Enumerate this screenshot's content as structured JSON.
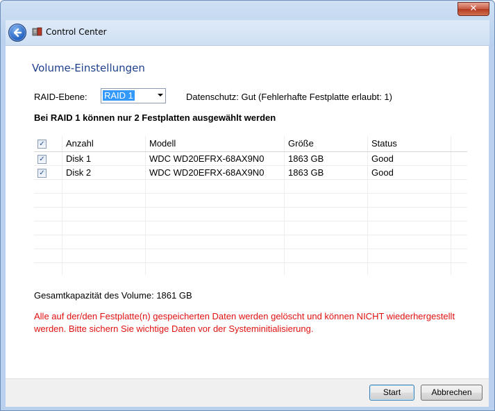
{
  "window": {
    "close_glyph": "✕",
    "app_title": "Control Center"
  },
  "page": {
    "title": "Volume-Einstellungen",
    "raid_label": "RAID-Ebene:",
    "raid_value": "RAID 1",
    "protection_text": "Datenschutz: Gut (Fehlerhafte Festplatte erlaubt: 1)",
    "raid_note": "Bei RAID 1 können nur 2 Festplatten ausgewählt werden"
  },
  "table": {
    "header_all_checked": true,
    "columns": [
      "Anzahl",
      "Modell",
      "Größe",
      "Status"
    ],
    "rows": [
      {
        "checked": true,
        "anzahl": "Disk 1",
        "modell": "WDC WD20EFRX-68AX9N0",
        "groesse": "1863 GB",
        "status": "Good"
      },
      {
        "checked": true,
        "anzahl": "Disk 2",
        "modell": "WDC WD20EFRX-68AX9N0",
        "groesse": "1863 GB",
        "status": "Good"
      }
    ]
  },
  "capacity_text": "Gesamtkapazität des Volume: 1861 GB",
  "warning_text": "Alle auf der/den Festplatte(n) gespeicherten Daten werden gelöscht und können NICHT wiederhergestellt werden.  Bitte sichern Sie wichtige Daten vor der Systeminitialisierung.",
  "buttons": {
    "start": "Start",
    "cancel": "Abbrechen"
  },
  "icons": {
    "back": "back-arrow-icon",
    "app": "control-center-icon",
    "check": "✓"
  },
  "colors": {
    "title_blue": "#1e3f8c",
    "warning_red": "#e01010",
    "selection_blue": "#3399ff"
  }
}
